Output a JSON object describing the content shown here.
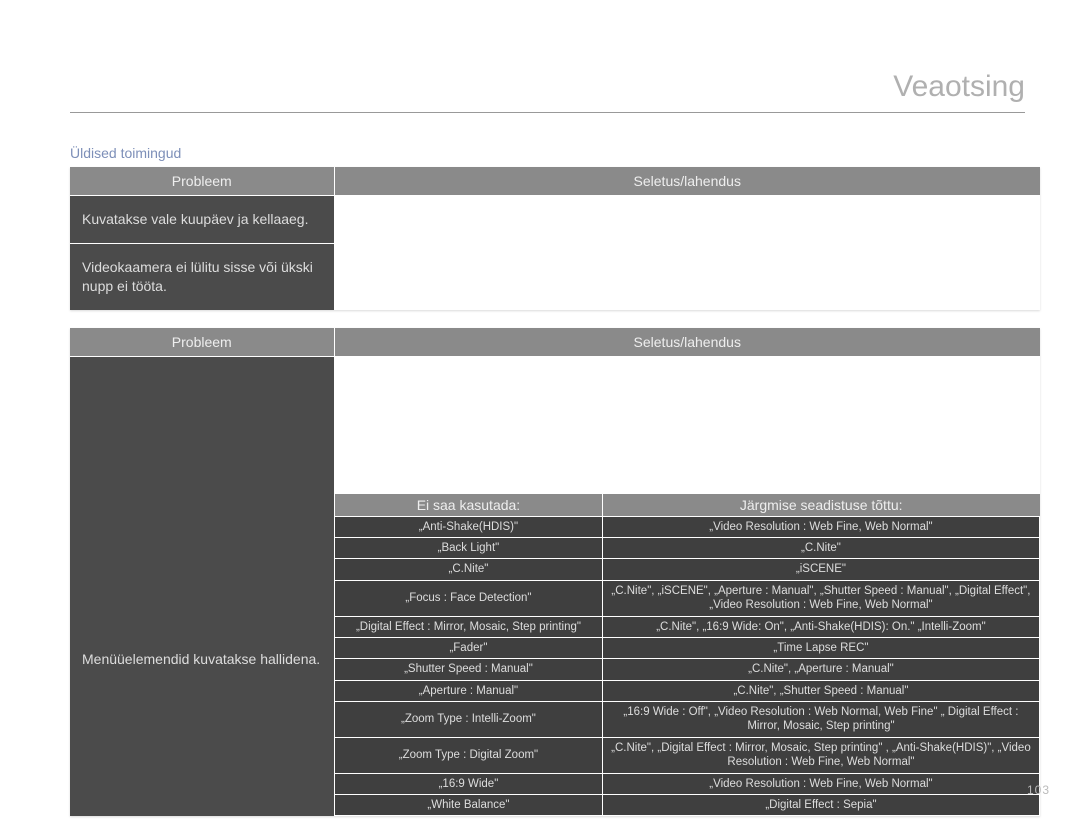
{
  "page": {
    "title": "Veaotsing",
    "page_number": "103"
  },
  "section1": {
    "heading": "Üldised toimingud",
    "header_problem": "Probleem",
    "header_solution": "Seletus/lahendus",
    "rows": [
      {
        "problem": "Kuvatakse vale kuupäev ja kellaaeg.",
        "solution": ""
      },
      {
        "problem": "Videokaamera ei lülitu sisse või ükski nupp ei tööta.",
        "solution": ""
      }
    ]
  },
  "section2": {
    "header_problem": "Probleem",
    "header_solution": "Seletus/lahendus",
    "row": {
      "problem": "Menüüelemendid kuvatakse hallidena.",
      "inner": {
        "header_left": "Ei saa kasutada:",
        "header_right": "Järgmise seadistuse tõttu:",
        "rows": [
          {
            "l": "„Anti-Shake(HDIS)\"",
            "r": "„Video Resolution : Web Fine, Web Normal\""
          },
          {
            "l": "„Back Light\"",
            "r": "„C.Nite\""
          },
          {
            "l": "„C.Nite\"",
            "r": "„iSCENE\""
          },
          {
            "l": "„Focus : Face Detection\"",
            "r": "„C.Nite\", „iSCENE\", „Aperture : Manual\", „Shutter Speed : Manual\", „Digital Effect\", „Video Resolution : Web Fine, Web Normal\""
          },
          {
            "l": "„Digital Effect : Mirror, Mosaic, Step printing\"",
            "r": "„C.Nite\", „16:9 Wide: On\", „Anti-Shake(HDIS): On.\" „Intelli-Zoom\""
          },
          {
            "l": "„Fader\"",
            "r": "„Time Lapse REC\""
          },
          {
            "l": "„Shutter Speed : Manual\"",
            "r": "„C.Nite\", „Aperture : Manual\""
          },
          {
            "l": "„Aperture : Manual\"",
            "r": "„C.Nite\", „Shutter Speed : Manual\""
          },
          {
            "l": "„Zoom Type : Intelli-Zoom\"",
            "r": "„16:9 Wide : Off\", „Video Resolution : Web Normal, Web Fine\" „ Digital Effect : Mirror, Mosaic, Step printing\""
          },
          {
            "l": "„Zoom Type : Digital Zoom\"",
            "r": "„C.Nite\", „Digital Effect : Mirror, Mosaic, Step printing\" , „Anti-Shake(HDIS)\", „Video Resolution : Web Fine, Web Normal\""
          },
          {
            "l": "„16:9 Wide\"",
            "r": "„Video Resolution : Web Fine, Web Normal\""
          },
          {
            "l": "„White Balance\"",
            "r": "„Digital Effect : Sepia\""
          }
        ]
      }
    }
  }
}
